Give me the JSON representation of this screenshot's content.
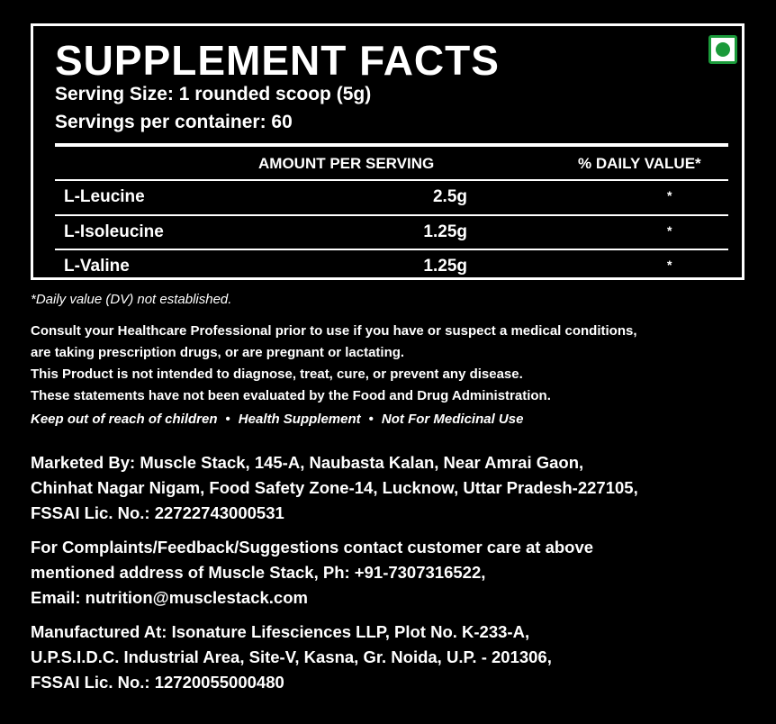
{
  "facts": {
    "title": "SUPPLEMENT FACTS",
    "serving_size": "Serving Size: 1 rounded scoop (5g)",
    "servings_per_container": "Servings per container: 60",
    "header_amount": "AMOUNT PER SERVING",
    "header_daily_value": "% DAILY VALUE*",
    "rows": [
      {
        "name": "L-Leucine",
        "amount": "2.5g",
        "dv": "*"
      },
      {
        "name": "L-Isoleucine",
        "amount": "1.25g",
        "dv": "*"
      },
      {
        "name": "L-Valine",
        "amount": "1.25g",
        "dv": "*"
      }
    ]
  },
  "dv_note": "*Daily value (DV) not established.",
  "warnings": [
    "Consult your Healthcare Professional prior to use if you have or suspect a medical conditions,",
    "are taking prescription drugs, or are pregnant or lactating.",
    "This Product is not intended to diagnose, treat, cure, or prevent any disease.",
    "These statements have not been evaluated by the Food and Drug Administration."
  ],
  "tags": [
    "Keep out of reach of children",
    "Health Supplement",
    "Not For Medicinal Use"
  ],
  "tag_separator": "•",
  "marketed": [
    "Marketed By: Muscle Stack, 145-A, Naubasta Kalan, Near Amrai Gaon,",
    "Chinhat Nagar Nigam, Food Safety Zone-14, Lucknow, Uttar Pradesh-227105,",
    "FSSAI Lic. No.: 22722743000531"
  ],
  "complaints": [
    "For Complaints/Feedback/Suggestions contact customer care at above",
    "mentioned address of Muscle Stack, Ph: +91-7307316522,",
    "Email: nutrition@musclestack.com"
  ],
  "manufactured": [
    "Manufactured At: Isonature Lifesciences LLP, Plot No. K-233-A,",
    "U.P.S.I.D.C. Industrial Area, Site-V, Kasna, Gr. Noida, U.P. - 201306,",
    "FSSAI Lic. No.: 12720055000480"
  ],
  "colors": {
    "background": "#000000",
    "text": "#ffffff",
    "veg_mark": "#1a9a3a"
  }
}
